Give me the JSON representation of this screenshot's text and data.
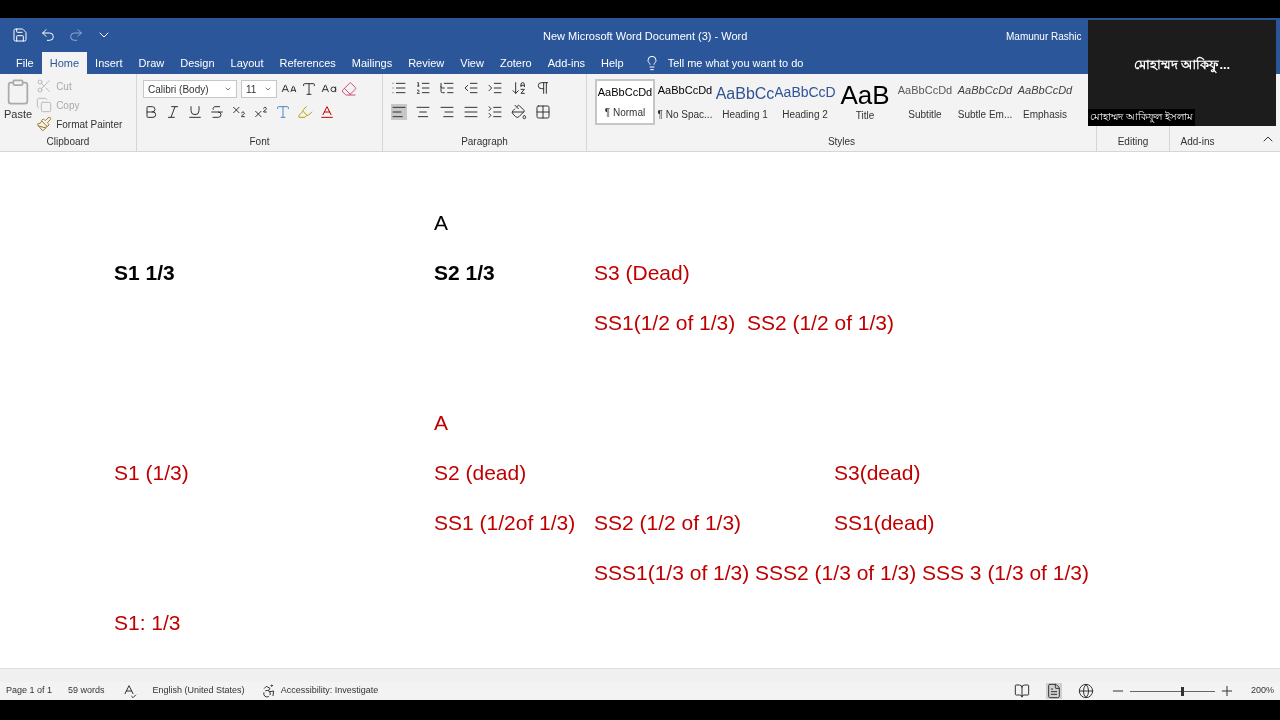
{
  "title": "New Microsoft Word Document (3)  -  Word",
  "user": "Mamunur Rashic",
  "tabs": [
    {
      "label": "File",
      "selected": false
    },
    {
      "label": "Home",
      "selected": true
    },
    {
      "label": "Insert",
      "selected": false
    },
    {
      "label": "Draw",
      "selected": false
    },
    {
      "label": "Design",
      "selected": false
    },
    {
      "label": "Layout",
      "selected": false
    },
    {
      "label": "References",
      "selected": false
    },
    {
      "label": "Mailings",
      "selected": false
    },
    {
      "label": "Review",
      "selected": false
    },
    {
      "label": "View",
      "selected": false
    },
    {
      "label": "Zotero",
      "selected": false
    },
    {
      "label": "Add-ins",
      "selected": false
    },
    {
      "label": "Help",
      "selected": false
    }
  ],
  "tell_me": "Tell me what you want to do",
  "clipboard": {
    "paste": "Paste",
    "cut": {
      "label": "Cut",
      "disabled": true
    },
    "copy": {
      "label": "Copy",
      "disabled": true
    },
    "format_painter": "Format Painter",
    "label": "Clipboard"
  },
  "font": {
    "name": "Calibri (Body)",
    "size": "11",
    "label": "Font"
  },
  "paragraph": {
    "label": "Paragraph"
  },
  "styles": {
    "label": "Styles",
    "items": [
      {
        "preview": "AaBbCcDd",
        "name": "¶ Normal",
        "kind": "normal",
        "selected": true
      },
      {
        "preview": "AaBbCcDd",
        "name": "¶ No Spac...",
        "kind": "normal",
        "selected": false
      },
      {
        "preview": "AaBbCc",
        "name": "Heading 1",
        "kind": "heading1",
        "selected": false
      },
      {
        "preview": "AaBbCcD",
        "name": "Heading 2",
        "kind": "heading2",
        "selected": false
      },
      {
        "preview": "AaB",
        "name": "Title",
        "kind": "title",
        "selected": false
      },
      {
        "preview": "AaBbCcDd",
        "name": "Subtitle",
        "kind": "subtitle",
        "selected": false
      },
      {
        "preview": "AaBbCcDd",
        "name": "Subtle Em...",
        "kind": "emphasis",
        "selected": false
      },
      {
        "preview": "AaBbCcDd",
        "name": "Emphasis",
        "kind": "emphasis",
        "selected": false
      }
    ]
  },
  "editing": {
    "label": "Editing"
  },
  "addins": {
    "label": "Add-ins"
  },
  "video_overlay": {
    "name": "মোহাম্মদ আকিফু...",
    "caption": "মোহাম্মদ আকিফুল ইসলাম"
  },
  "document": {
    "lines": [
      [
        {
          "text": "A",
          "bold": false,
          "color": "#000000"
        }
      ],
      [
        {
          "text": "S1 1/3",
          "bold": true,
          "color": "#000000"
        },
        {
          "text": "S2 1/3",
          "bold": true,
          "color": "#000000"
        },
        {
          "text": "S3 (Dead)",
          "bold": false,
          "color": "#c00000"
        }
      ],
      [
        {
          "text": "SS1(1/2 of 1/3)  SS2 (1/2 of 1/3)",
          "bold": false,
          "color": "#c00000"
        }
      ],
      [
        {
          "text": "A",
          "bold": false,
          "color": "#c00000"
        }
      ],
      [
        {
          "text": "S1 (1/3)",
          "bold": false,
          "color": "#c00000"
        },
        {
          "text": "S2 (dead)",
          "bold": false,
          "color": "#c00000"
        },
        {
          "text": "S3(dead)",
          "bold": false,
          "color": "#c00000"
        }
      ],
      [
        {
          "text": "SS1 (1/2of 1/3)",
          "bold": false,
          "color": "#c00000"
        },
        {
          "text": "SS2 (1/2 of 1/3)",
          "bold": false,
          "color": "#c00000"
        },
        {
          "text": "SS1(dead)",
          "bold": false,
          "color": "#c00000"
        }
      ],
      [
        {
          "text": "SSS1(1/3 of 1/3) SSS2 (1/3 of 1/3) SSS 3 (1/3 of 1/3)",
          "bold": false,
          "color": "#c00000"
        }
      ],
      [
        {
          "text": "S1: 1/3",
          "bold": false,
          "color": "#c00000"
        }
      ]
    ]
  },
  "status_bar": {
    "page": "Page 1 of 1",
    "words": "59 words",
    "language": "English (United States)",
    "accessibility": "Accessibility: Investigate",
    "zoom": "200%",
    "zoom_slider": {
      "level": 0.6
    }
  }
}
